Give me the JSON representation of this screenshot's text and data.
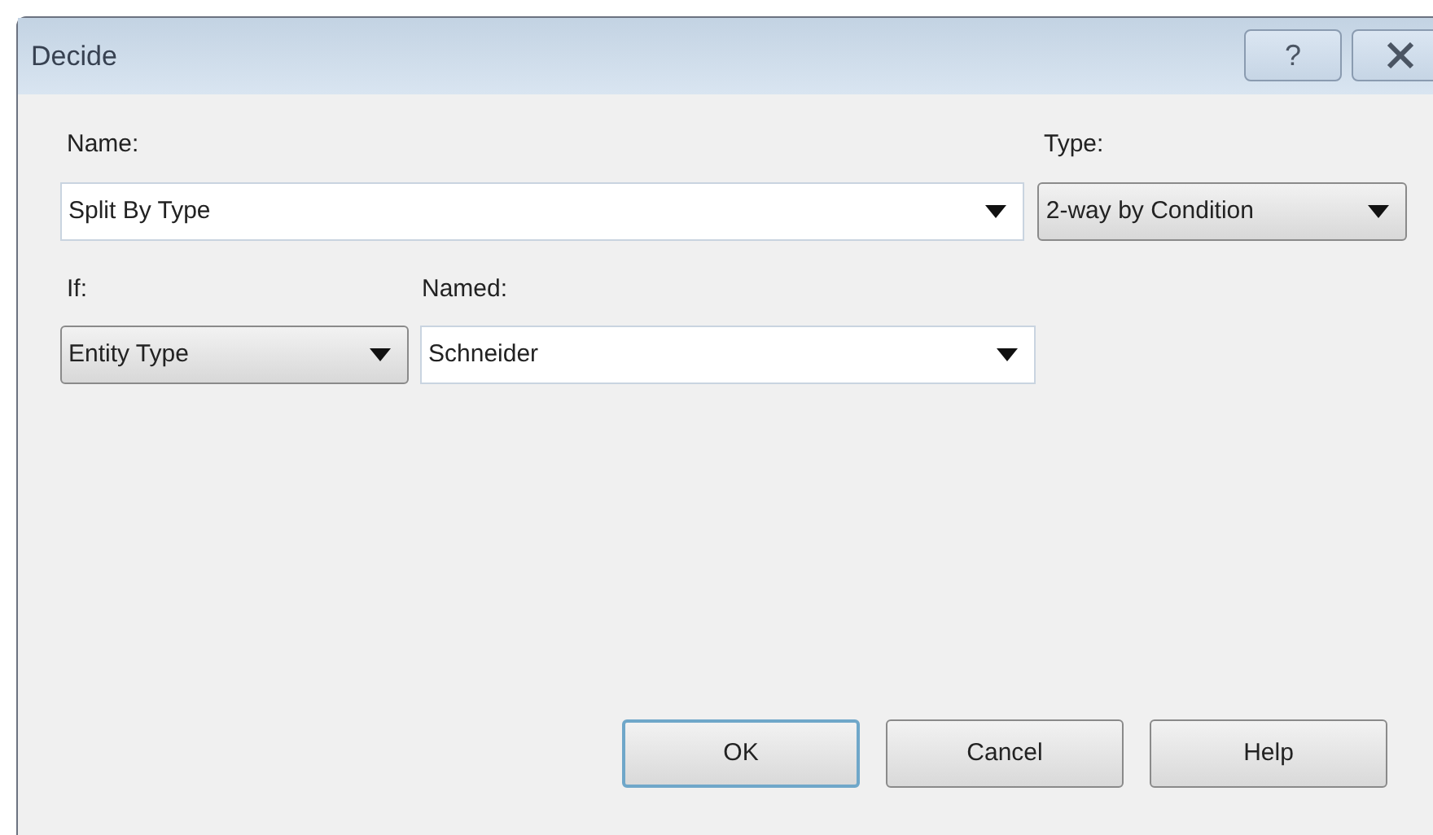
{
  "window": {
    "title": "Decide",
    "controls": [
      {
        "kind": "help",
        "label": "?"
      },
      {
        "kind": "close"
      }
    ]
  },
  "name_field": {
    "label": "Name:",
    "value": "Split By Type",
    "kind": "combo"
  },
  "type_field": {
    "label": "Type:",
    "value": "2-way by Condition",
    "kind": "dropdown"
  },
  "if_field": {
    "label": "If:",
    "value": "Entity Type",
    "kind": "dropdown"
  },
  "named_field": {
    "label": "Named:",
    "value": "Schneider",
    "kind": "combo"
  },
  "buttons": [
    {
      "label": "OK",
      "default": true
    },
    {
      "label": "Cancel",
      "default": false
    },
    {
      "label": "Help",
      "default": false
    }
  ]
}
